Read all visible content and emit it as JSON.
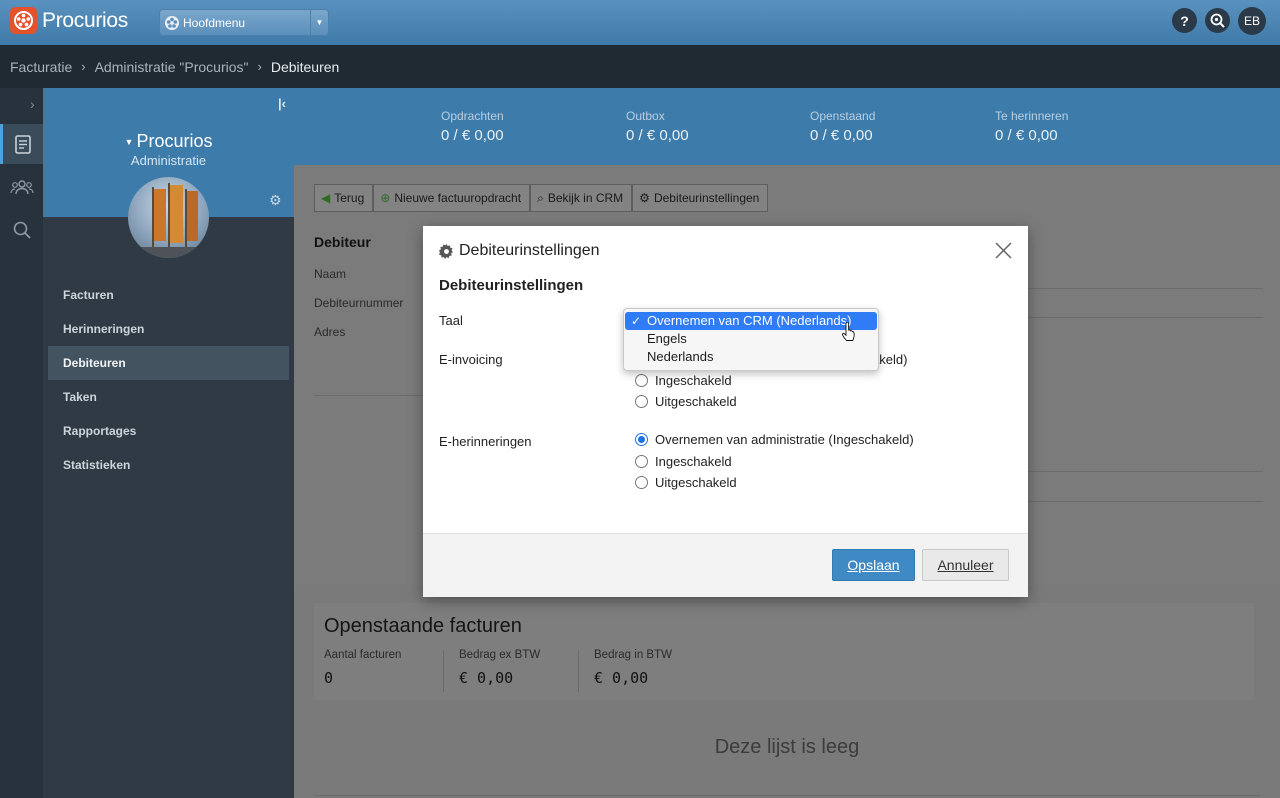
{
  "app": {
    "name": "Procurios",
    "main_menu": "Hoofdmenu",
    "user_initials": "EB",
    "help_glyph": "?"
  },
  "breadcrumb": [
    "Facturatie",
    "Administratie \"Procurios\"",
    "Debiteuren"
  ],
  "breadcrumb_sep": "›",
  "sidebar": {
    "org_name": "Procurios",
    "org_type": "Administratie",
    "items": [
      {
        "label": "Facturen",
        "active": false
      },
      {
        "label": "Herinneringen",
        "active": false
      },
      {
        "label": "Debiteuren",
        "active": true
      },
      {
        "label": "Taken",
        "active": false
      },
      {
        "label": "Rapportages",
        "active": false
      },
      {
        "label": "Statistieken",
        "active": false
      }
    ]
  },
  "stats": [
    {
      "label": "Opdrachten",
      "value": "0 / € 0,00"
    },
    {
      "label": "Outbox",
      "value": "0 / € 0,00"
    },
    {
      "label": "Openstaand",
      "value": "0 / € 0,00"
    },
    {
      "label": "Te herinneren",
      "value": "0 / € 0,00"
    }
  ],
  "toolbar": {
    "back": "Terug",
    "new_order": "Nieuwe factuuropdracht",
    "view_crm": "Bekijk in CRM",
    "settings": "Debiteurinstellingen"
  },
  "debtor": {
    "title": "Debiteur",
    "labels": [
      "Naam",
      "Debiteurnummer",
      "Adres"
    ]
  },
  "open_invoices": {
    "title": "Openstaande facturen",
    "cols": [
      {
        "label": "Aantal facturen",
        "value": "0"
      },
      {
        "label": "Bedrag ex BTW",
        "value": "€ 0,00"
      },
      {
        "label": "Bedrag in BTW",
        "value": "€ 0,00"
      }
    ],
    "empty": "Deze lijst is leeg"
  },
  "modal": {
    "title": "Debiteurinstellingen",
    "section": "Debiteurinstellingen",
    "language_label": "Taal",
    "language_options": [
      {
        "label": "Overnemen van CRM (Nederlands)",
        "selected": true
      },
      {
        "label": "Engels",
        "selected": false
      },
      {
        "label": "Nederlands",
        "selected": false
      }
    ],
    "einvoicing_label": "E-invoicing",
    "einvoicing_partial": "akeld)",
    "einvoicing_options": [
      {
        "label": "Ingeschakeld",
        "checked": false
      },
      {
        "label": "Uitgeschakeld",
        "checked": false
      }
    ],
    "ereminders_label": "E-herinneringen",
    "ereminders_options": [
      {
        "label": "Overnemen van administratie (Ingeschakeld)",
        "checked": true
      },
      {
        "label": "Ingeschakeld",
        "checked": false
      },
      {
        "label": "Uitgeschakeld",
        "checked": false
      }
    ],
    "save": "Opslaan",
    "cancel": "Annuleer"
  },
  "colors": {
    "brand_orange": "#e2522c",
    "header_blue": "#3d7bab",
    "primary_button": "#3f8ac4",
    "select_highlight": "#2f7cf6"
  }
}
